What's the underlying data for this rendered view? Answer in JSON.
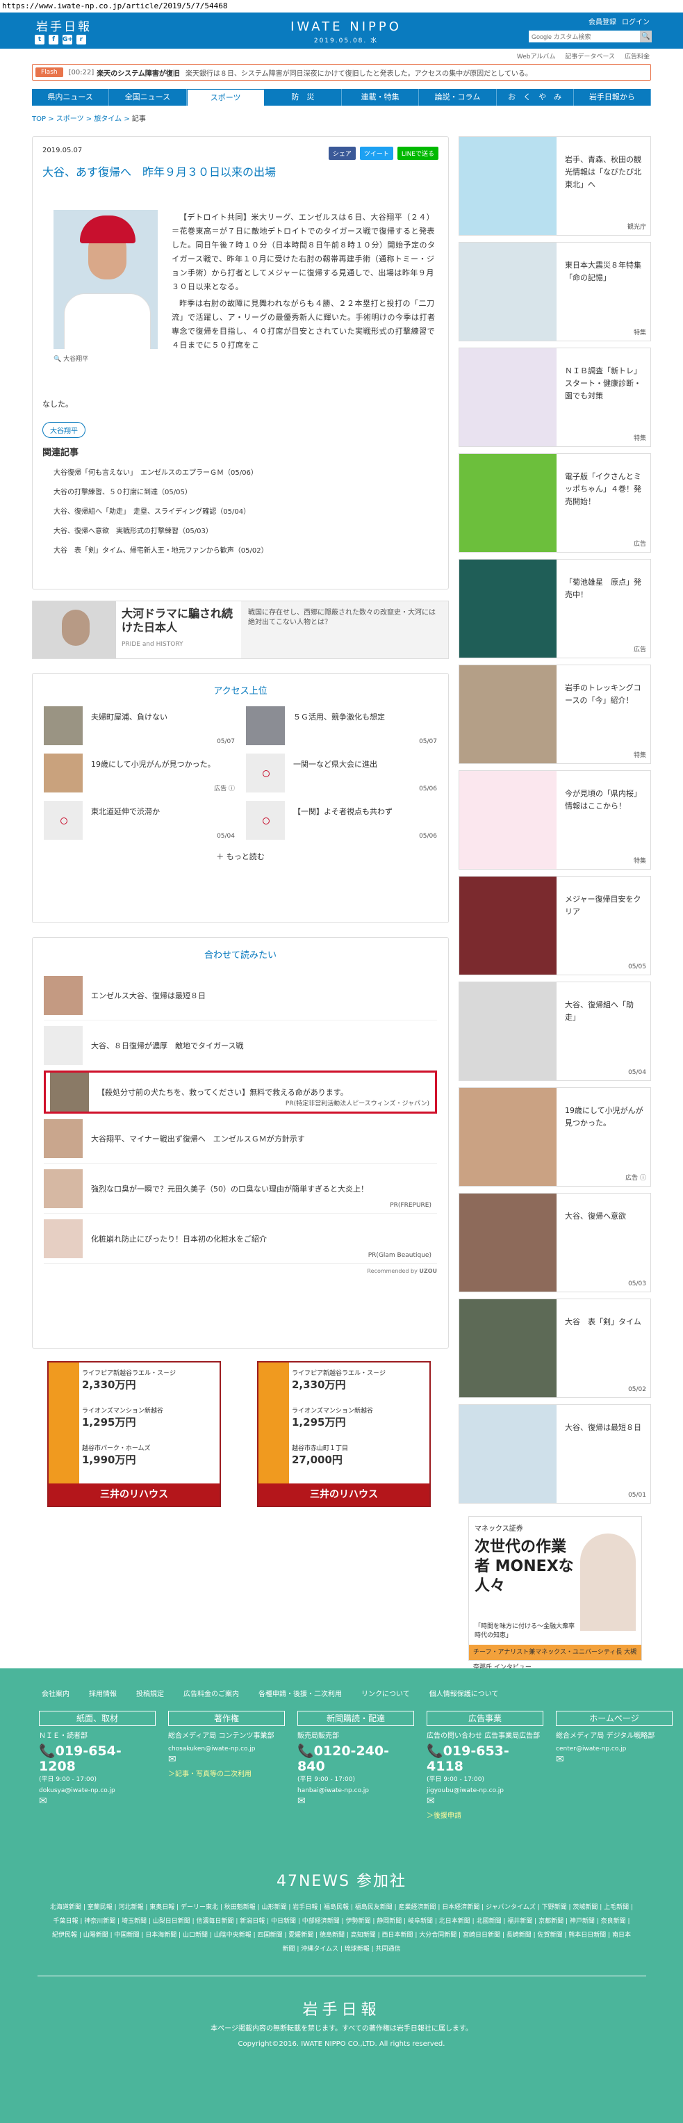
{
  "url": "https://www.iwate-np.co.jp/article/2019/5/7/54468",
  "header": {
    "logo": "岩手日報",
    "center_logo": "IWATE NIPPO",
    "center_date": "2019.05.08. 水",
    "links": [
      "会員登録",
      "ログイン"
    ],
    "search_placeholder": "Google カスタム検索",
    "social": [
      "t",
      "f",
      "G+",
      "r"
    ]
  },
  "subnav": [
    "Webアルバム",
    "記事データベース",
    "広告料金"
  ],
  "flash": {
    "tag": "Flash",
    "time": "[00:22]",
    "title": "楽天のシステム障害が復旧",
    "body": "楽天銀行は８日、システム障害が同日深夜にかけて復旧したと発表した。アクセスの集中が原因だとしている。"
  },
  "gnav": [
    "県内ニュース",
    "全国ニュース",
    "スポーツ",
    "防　災",
    "連載・特集",
    "論説・コラム",
    "お　く　や　み",
    "岩手日報から"
  ],
  "breadcrumb": [
    "TOP",
    "スポーツ",
    "旅タイム",
    "記事"
  ],
  "article": {
    "date": "2019.05.07",
    "share": [
      "シェア",
      "ツイート",
      "LINEで送る"
    ],
    "title": "大谷、あす復帰へ　昨年９月３０日以来の出場",
    "caption": "大谷翔平",
    "paragraphs": [
      "【デトロイト共同】米大リーグ、エンゼルスは６日、大谷翔平（２４）＝花巻東高＝が７日に敵地デトロイトでのタイガース戦で復帰すると発表した。同日午後７時１０分（日本時間８日午前８時１０分）開始予定のタイガース戦で、昨年１０月に受けた右肘の靱帯再建手術（通称トミー・ジョン手術）から打者としてメジャーに復帰する見通しで、出場は昨年９月３０日以来となる。",
      "昨季は右肘の故障に見舞われながらも４勝、２２本塁打と投打の「二刀流」で活躍し、ア・リーグの最優秀新人に輝いた。手術明けの今季は打者専念で復帰を目指し、４０打席が目安とされていた実戦形式の打撃練習で４日までに５０打席をこ"
    ],
    "tail": "なした。",
    "tag": "大谷翔平"
  },
  "related": {
    "heading": "関連記事",
    "items": [
      "大谷復帰「何も言えない」　エンゼルスのエプラーＧＭ（05/06）",
      "大谷の打撃練習、５０打席に到達（05/05）",
      "大谷、復帰組へ「助走」　走塁、スライディング確認（05/04）",
      "大谷、復帰へ意欲　実戦形式の打撃練習（05/03）",
      "大谷　表「剣」タイム、帰宅新人王・地元ファンから歓声（05/02）"
    ]
  },
  "ad_row": {
    "headline": "大河ドラマに騙され続けた日本人",
    "source": "PRIDE and HISTORY",
    "text": "戦国に存在せし、西郷に隠蔽された数々の改竄史・大河には絶対出てこない人物とは？"
  },
  "ranking": {
    "heading": "アクセス上位",
    "items": [
      {
        "title": "夫婦町屋浦、負けない",
        "date": "05/07"
      },
      {
        "title": "５Ｇ活用、競争激化も想定",
        "date": "05/07"
      },
      {
        "title": "19歳にして小児がんが見つかった。",
        "date": "広告 ⓘ"
      },
      {
        "title": "一関一など県大会に進出",
        "date": "05/06"
      },
      {
        "title": "東北道延伸で渋滞か",
        "date": "05/04"
      },
      {
        "title": "【一関】よそ者視点も共わず",
        "date": "05/06"
      }
    ],
    "more": "もっと読む"
  },
  "recommend": {
    "heading": "合わせて読みたい",
    "items": [
      {
        "title": "エンゼルス大谷、復帰は最短８日",
        "src": ""
      },
      {
        "title": "大谷、８日復帰が濃厚　敵地でタイガース戦",
        "src": ""
      },
      {
        "title": "【殺処分寸前の犬たちを、救ってください】無料で救える命があります。",
        "src": "PR(特定非営利活動法人ピースウィンズ・ジャパン)"
      },
      {
        "title": "大谷翔平、マイナー戦出ず復帰へ　エンゼルスＧＭが方針示す",
        "src": ""
      },
      {
        "title": "強烈な口臭が一瞬で？元田久美子（50）の口臭ない理由が簡単すぎると大炎上！",
        "src": "PR(FREPURE)"
      },
      {
        "title": "化粧崩れ防止にぴったり！日本初の化粧水をご紹介",
        "src": "PR(Glam Beautique)"
      }
    ],
    "by": "Recommended by"
  },
  "banners": [
    {
      "r1": "ライフピア新越谷ラエル・ス－ジ",
      "p1": "2,330",
      "r2": "ライオンズマンション新越谷",
      "p2": "1,295",
      "r3": "越谷市パーク・ホームズ",
      "p3": "1,990",
      "foot": "三井のリハウス"
    },
    {
      "r1": "ライフピア新越谷ラエル・ス－ジ",
      "p1": "2,330",
      "r2": "ライオンズマンション新越谷",
      "p2": "1,295",
      "r3": "越谷市赤山町１丁目",
      "p3": "27,000",
      "foot": "三井のリハウス"
    }
  ],
  "sidebar": {
    "items": [
      {
        "title": "岩手、青森、秋田の観光情報は「なびたび北東北」へ",
        "src": "観光庁"
      },
      {
        "title": "東日本大震災８年特集「命の記憶」",
        "src": "特集"
      },
      {
        "title": "ＮＩＢ調査「新トレ」スタート・健康診断・園でも対策",
        "src": "特集"
      },
      {
        "title": "電子版「イクさんとミッポちゃん」４巻！発売開始！",
        "src": "広告"
      },
      {
        "title": "「菊池雄星　原点」発売中！",
        "src": "広告"
      },
      {
        "title": "岩手のトレッキングコースの「今」紹介！",
        "src": "特集"
      },
      {
        "title": "今が見頃の「県内桜」情報はここから！",
        "src": "特集"
      },
      {
        "title": "メジャー復帰目安をクリア",
        "src": "05/05"
      },
      {
        "title": "大谷、復帰組へ「助走」",
        "src": "05/04"
      },
      {
        "title": "19歳にして小児がんが見つかった。",
        "src": "広告 ⓘ"
      },
      {
        "title": "大谷、復帰へ意欲",
        "src": "05/03"
      },
      {
        "title": "大谷　表「剣」タイム",
        "src": "05/02"
      },
      {
        "title": "大谷、復帰は最短８日",
        "src": "05/01"
      }
    ],
    "ad": {
      "brand": "マネックス証券",
      "big": "次世代の作業者 MONEXな人々",
      "small": "「時間を味方に付ける〜金融大衆率時代の知恵」",
      "strip": "チーフ・アナリスト兼マネックス・ユニバーシティ長 大槻奈那氏 インタビュー"
    }
  },
  "footer": {
    "links": [
      "会社案内",
      "採用情報",
      "投稿規定",
      "広告料金のご案内",
      "各種申請・後援・二次利用",
      "リンクについて",
      "個人情報保護について"
    ],
    "cols": [
      {
        "head": "紙面、取材",
        "label": "ＮＩＥ・読者部",
        "tel": "019-654-1208",
        "hours": "(平日 9:00 - 17:00)",
        "mail": "dokusya@iwate-np.co.jp",
        "extra": ""
      },
      {
        "head": "著作権",
        "label": "総合メディア局 コンテンツ事業部",
        "tel": "",
        "hours": "",
        "mail": "chosakuken@iwate-np.co.jp",
        "extra": "＞記事・写真等の二次利用"
      },
      {
        "head": "新聞購読・配達",
        "label": "販売局販売部",
        "tel": "0120-240-840",
        "hours": "(平日 9:00 - 17:00)",
        "mail": "hanbai@iwate-np.co.jp",
        "extra": ""
      },
      {
        "head": "広告事業",
        "label": "広告の問い合わせ 広告事業局広告部",
        "tel": "019-653-4118",
        "hours": "(平日 9:00 - 17:00)",
        "mail": "jigyoubu@iwate-np.co.jp",
        "extra": "＞後援申請"
      },
      {
        "head": "ホームページ",
        "label": "総合メディア局 デジタル戦略部",
        "tel": "",
        "hours": "",
        "mail": "center@iwate-np.co.jp",
        "extra": ""
      }
    ],
    "news47": "47NEWS 参加社",
    "papers": "北海道新聞 | 室蘭民報 | 河北新報 | 東奥日報 | デーリー東北 | 秋田魁新報 | 山形新聞 | 岩手日報 | 福島民報 | 福島民友新聞 | 産業経済新聞 | 日本経済新聞 | ジャパンタイムズ | 下野新聞 | 茨城新聞 | 上毛新聞 | 千葉日報 | 神奈川新聞 | 埼玉新聞 | 山梨日日新聞 | 信濃毎日新聞 | 新潟日報 | 中日新聞 | 中部経済新聞 | 伊勢新聞 | 静岡新聞 | 岐阜新聞 | 北日本新聞 | 北國新聞 | 福井新聞 | 京都新聞 | 神戸新聞 | 奈良新聞 | 紀伊民報 | 山陽新聞 | 中国新聞 | 日本海新聞 | 山口新聞 | 山陰中央新報 | 四国新聞 | 愛媛新聞 | 徳島新聞 | 高知新聞 | 西日本新聞 | 大分合同新聞 | 宮崎日日新聞 | 長崎新聞 | 佐賀新聞 | 熊本日日新聞 | 南日本新聞 | 沖縄タイムス | 琉球新報 | 共同通信",
    "logo": "岩手日報",
    "notice": "本ページ掲載内容の無断転載を禁じます。すべての著作権は岩手日報社に属します。",
    "copyright": "Copyright©2016. IWATE NIPPO CO.,LTD. All rights reserved."
  }
}
